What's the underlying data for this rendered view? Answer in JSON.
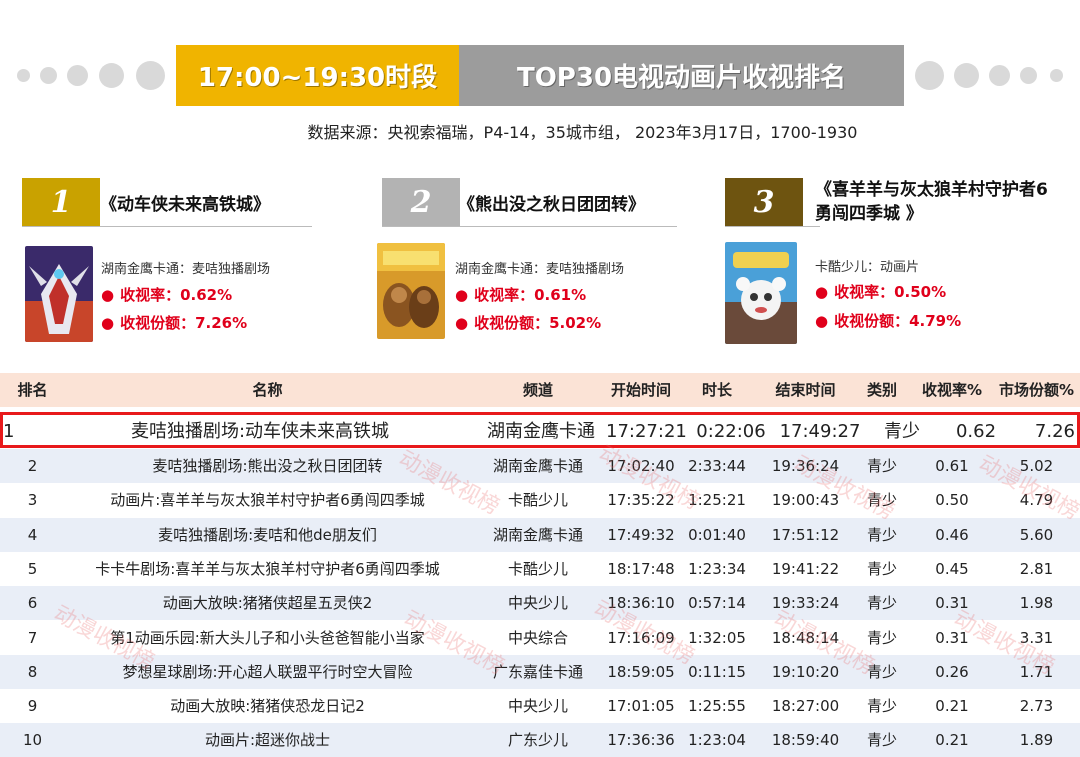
{
  "banner": {
    "time_slot": "17:00~19:30时段",
    "title": "TOP30电视动画片收视排名"
  },
  "source_line": "数据来源：央视索福瑞，P4-14，35城市组，  2023年3月17日，1700-1930",
  "top3": [
    {
      "rank": "1",
      "title": "《动车侠未来高铁城》",
      "channel": "湖南金鹰卡通：麦咭独播剧场",
      "rating": "收视率：0.62%",
      "share": "收视份额：7.26%",
      "badge_color": "#c9a200"
    },
    {
      "rank": "2",
      "title": "《熊出没之秋日团团转》",
      "channel": "湖南金鹰卡通：麦咭独播剧场",
      "rating": "收视率：0.61%",
      "share": "收视份额：5.02%",
      "badge_color": "#b3b3b3"
    },
    {
      "rank": "3",
      "title_line1": "《喜羊羊与灰太狼羊村守护者6",
      "title_line2": "勇闯四季城 》",
      "channel": "卡酷少儿：动画片",
      "rating": "收视率：0.50%",
      "share": "收视份额：4.79%",
      "badge_color": "#6e5410"
    }
  ],
  "table": {
    "headers": [
      "排名",
      "名称",
      "频道",
      "开始时间",
      "时长",
      "结束时间",
      "类别",
      "收视率%",
      "市场份额%"
    ],
    "rows": [
      [
        "1",
        "麦咭独播剧场:动车侠未来高铁城",
        "湖南金鹰卡通",
        "17:27:21",
        "0:22:06",
        "17:49:27",
        "青少",
        "0.62",
        "7.26"
      ],
      [
        "2",
        "麦咭独播剧场:熊出没之秋日团团转",
        "湖南金鹰卡通",
        "17:02:40",
        "2:33:44",
        "19:36:24",
        "青少",
        "0.61",
        "5.02"
      ],
      [
        "3",
        "动画片:喜羊羊与灰太狼羊村守护者6勇闯四季城",
        "卡酷少儿",
        "17:35:22",
        "1:25:21",
        "19:00:43",
        "青少",
        "0.50",
        "4.79"
      ],
      [
        "4",
        "麦咭独播剧场:麦咭和他de朋友们",
        "湖南金鹰卡通",
        "17:49:32",
        "0:01:40",
        "17:51:12",
        "青少",
        "0.46",
        "5.60"
      ],
      [
        "5",
        "卡卡牛剧场:喜羊羊与灰太狼羊村守护者6勇闯四季城",
        "卡酷少儿",
        "18:17:48",
        "1:23:34",
        "19:41:22",
        "青少",
        "0.45",
        "2.81"
      ],
      [
        "6",
        "动画大放映:猪猪侠超星五灵侠2",
        "中央少儿",
        "18:36:10",
        "0:57:14",
        "19:33:24",
        "青少",
        "0.31",
        "1.98"
      ],
      [
        "7",
        "第1动画乐园:新大头儿子和小头爸爸智能小当家",
        "中央综合",
        "17:16:09",
        "1:32:05",
        "18:48:14",
        "青少",
        "0.31",
        "3.31"
      ],
      [
        "8",
        "梦想星球剧场:开心超人联盟平行时空大冒险",
        "广东嘉佳卡通",
        "18:59:05",
        "0:11:15",
        "19:10:20",
        "青少",
        "0.26",
        "1.71"
      ],
      [
        "9",
        "动画大放映:猪猪侠恐龙日记2",
        "中央少儿",
        "17:01:05",
        "1:25:55",
        "18:27:00",
        "青少",
        "0.21",
        "2.73"
      ],
      [
        "10",
        "动画片:超迷你战士",
        "广东少儿",
        "17:36:36",
        "1:23:04",
        "18:59:40",
        "青少",
        "0.21",
        "1.89"
      ]
    ]
  },
  "watermark_text": "动漫收视榜",
  "colors": {
    "banner_yellow": "#f0b400",
    "banner_gray": "#9c9c9c",
    "stat_red": "#e0001b",
    "highlight_border": "#e8191b",
    "header_row": "#fbe3d6",
    "alt_row": "#e9eef7"
  }
}
